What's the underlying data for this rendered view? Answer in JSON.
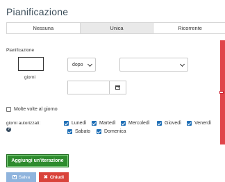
{
  "title": "Pianificazione",
  "tabs": [
    {
      "label": "Nessuna"
    },
    {
      "label": "Unica"
    },
    {
      "label": "Ricorrente"
    }
  ],
  "form": {
    "section_label": "Pianificazione",
    "days_label": "giorni",
    "when_select_value": "dopo",
    "many_times_label": "Molte volte al giorno",
    "allowed_days_label": "giorni autorizzati:",
    "days": [
      {
        "label": "Lunedì",
        "checked": true
      },
      {
        "label": "Martedì",
        "checked": true
      },
      {
        "label": "Mercoledì",
        "checked": true
      },
      {
        "label": "Giovedì",
        "checked": true
      },
      {
        "label": "Venerdì",
        "checked": true
      },
      {
        "label": "Sabato",
        "checked": true
      },
      {
        "label": "Domenica",
        "checked": true
      }
    ]
  },
  "buttons": {
    "add_iteration": "Aggiungi un'iterazione",
    "save": "Salva",
    "close": "Chiudi"
  },
  "colors": {
    "accent_blue": "#1f6fb6",
    "add_green": "#2e8b2e",
    "close_red": "#d9433a",
    "side_panel_red": "#e0454a"
  },
  "icons": {
    "calendar": "calendar-icon",
    "help": "question-icon",
    "save": "floppy-disk-icon",
    "close": "x-icon"
  }
}
